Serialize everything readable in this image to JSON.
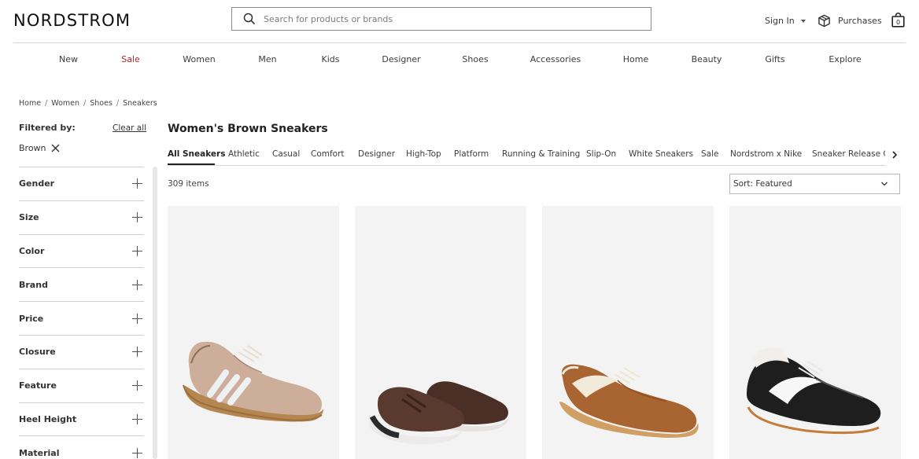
{
  "header": {
    "logo": "NORDSTROM",
    "search_placeholder": "Search for products or brands",
    "sign_in": "Sign In",
    "purchases": "Purchases",
    "bag_count": "0"
  },
  "main_nav": [
    "New",
    "Sale",
    "Women",
    "Men",
    "Kids",
    "Designer",
    "Shoes",
    "Accessories",
    "Home",
    "Beauty",
    "Gifts",
    "Explore"
  ],
  "breadcrumb": [
    "Home",
    "Women",
    "Shoes",
    "Sneakers"
  ],
  "breadcrumb_sep": "/",
  "sidebar": {
    "filtered_by": "Filtered by:",
    "clear_all": "Clear all",
    "active_filter": "Brown",
    "facets": [
      "Gender",
      "Size",
      "Color",
      "Brand",
      "Price",
      "Closure",
      "Feature",
      "Heel Height",
      "Material"
    ]
  },
  "results": {
    "title": "Women's Brown Sneakers",
    "subnav": [
      "All Sneakers",
      "Athletic",
      "Casual",
      "Comfort",
      "Designer",
      "High-Top",
      "Platform",
      "Running & Training",
      "Slip-On",
      "White Sneakers",
      "Sale",
      "Nordstrom x Nike",
      "Sneaker Release C"
    ],
    "count": "309 items",
    "sort": "Sort: Featured"
  },
  "colors": {
    "sale": "#b5272d",
    "text": "#393939",
    "card_bg": "#f3f3f3"
  },
  "products": [
    {
      "icon": "tan-suede-sneaker-with-white-stripes"
    },
    {
      "icon": "brown-running-sneaker-pair"
    },
    {
      "icon": "brown-suede-sneaker-with-cream-stripe"
    },
    {
      "icon": "black-sneaker-with-white-stripe-and-shearling-collar"
    }
  ]
}
